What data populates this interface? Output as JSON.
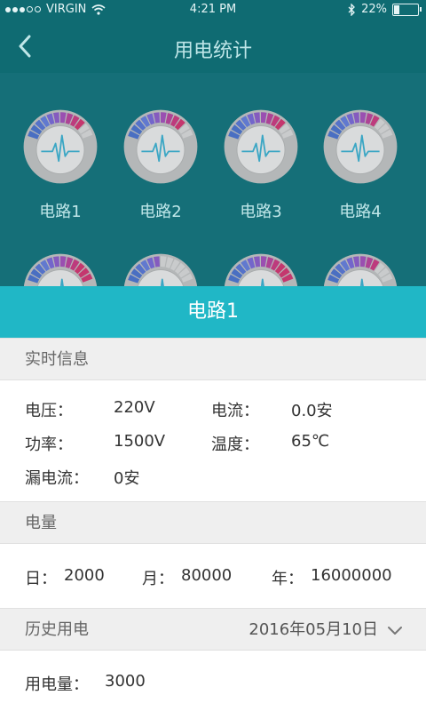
{
  "status": {
    "carrier": "VIRGIN",
    "time": "4:21 PM",
    "battery": "22%",
    "battery_level": 0.22
  },
  "header": {
    "title": "用电统计"
  },
  "circuits": [
    {
      "label": "电路1",
      "fill": 10
    },
    {
      "label": "电路2",
      "fill": 10
    },
    {
      "label": "电路3",
      "fill": 10
    },
    {
      "label": "电路4",
      "fill": 9
    },
    {
      "label": "",
      "fill": 12
    },
    {
      "label": "",
      "fill": 6
    },
    {
      "label": "",
      "fill": 12
    },
    {
      "label": "",
      "fill": 9
    }
  ],
  "panel": {
    "title": "电路1"
  },
  "realtime": {
    "section_title": "实时信息",
    "voltage_label": "电压：",
    "voltage_value": "220V",
    "current_label": "电流：",
    "current_value": "0.0安",
    "power_label": "功率：",
    "power_value": "1500V",
    "temp_label": "温度：",
    "temp_value": "65℃",
    "leak_label": "漏电流：",
    "leak_value": "0安"
  },
  "energy": {
    "section_title": "电量",
    "day_label": "日：",
    "day_value": "2000",
    "month_label": "月：",
    "month_value": "80000",
    "year_label": "年：",
    "year_value": "16000000"
  },
  "history": {
    "section_title": "历史用电",
    "date": "2016年05月10日",
    "usage_label": "用电量：",
    "usage_value": "3000"
  }
}
